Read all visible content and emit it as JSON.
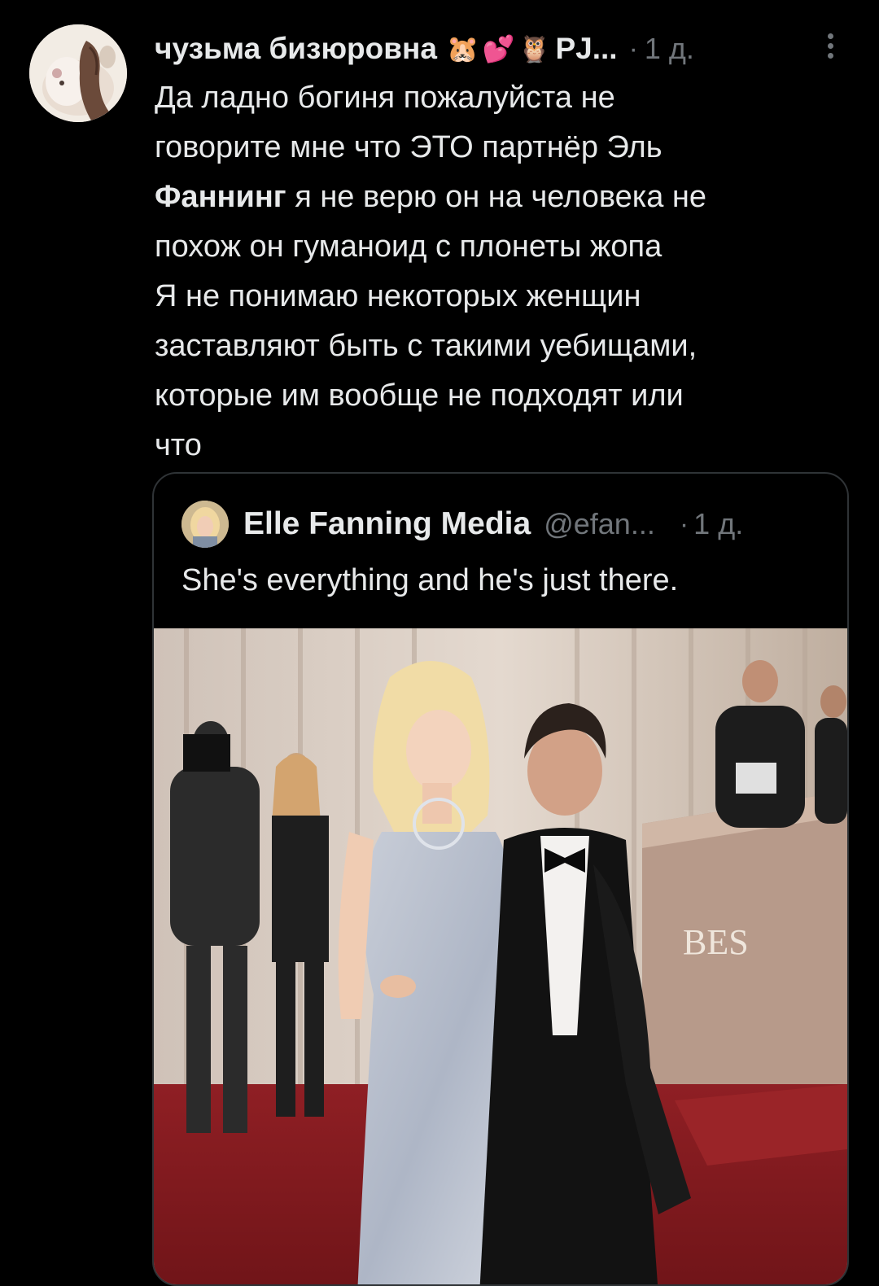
{
  "post": {
    "author": {
      "name": "чузьма бизюровна",
      "emoji": [
        "🐹",
        "💕",
        "🦉"
      ],
      "handle_short": "PJ...",
      "time": "1 д."
    },
    "text_lines": [
      "Да ладно богиня пожалуйста не",
      "говорите мне что ЭТО партнёр Эль",
      "я не верю он на человека не",
      "похож он гуманоид с плонеты жопа",
      "Я не понимаю некоторых женщин",
      "заставляют быть с такими уебищами,",
      "которые им вообще не подходят или",
      "что"
    ],
    "bold_word": "Фаннинг",
    "quote": {
      "name": "Elle Fanning Media",
      "handle": "@efan...",
      "time": "1 д.",
      "text": "She's everything and he's just there.",
      "media_sign_text": "BES"
    }
  },
  "colors": {
    "background": "#000000",
    "text": "#e7e9ea",
    "muted": "#71767b",
    "border": "#2f3336"
  },
  "icons": {
    "more": "more-vertical-icon"
  }
}
